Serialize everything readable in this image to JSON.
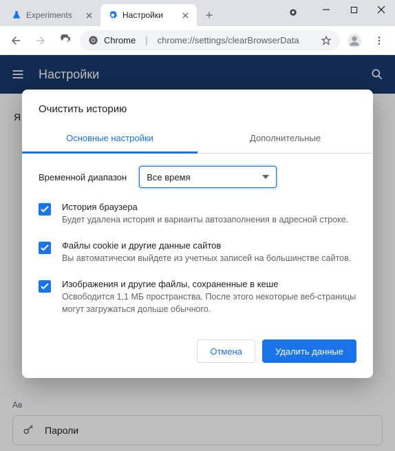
{
  "tabs": [
    {
      "title": "Experiments",
      "favicon": "flask"
    },
    {
      "title": "Настройки",
      "favicon": "gear"
    }
  ],
  "omnibox": {
    "label": "Chrome",
    "scheme": "chrome://",
    "path": "settings/clearBrowserData"
  },
  "settings_header": {
    "title": "Настройки"
  },
  "backdrop": {
    "ya": "Я и",
    "autofill_label": "Ав",
    "passwords": "Пароли"
  },
  "modal": {
    "title": "Очистить историю",
    "tabs": {
      "basic": "Основные настройки",
      "advanced": "Дополнительные"
    },
    "range_label": "Временной диапазон",
    "range_value": "Все время",
    "items": [
      {
        "title": "История браузера",
        "desc": "Будет удалена история и варианты автозаполнения в адресной строке."
      },
      {
        "title": "Файлы cookie и другие данные сайтов",
        "desc": "Вы автоматически выйдете из учетных записей на большинстве сайтов."
      },
      {
        "title": "Изображения и другие файлы, сохраненные в кеше",
        "desc": "Освободится 1,1 МБ пространства. После этого некоторые веб-страницы могут загружаться дольше обычного."
      }
    ],
    "buttons": {
      "cancel": "Отмена",
      "confirm": "Удалить данные"
    }
  }
}
